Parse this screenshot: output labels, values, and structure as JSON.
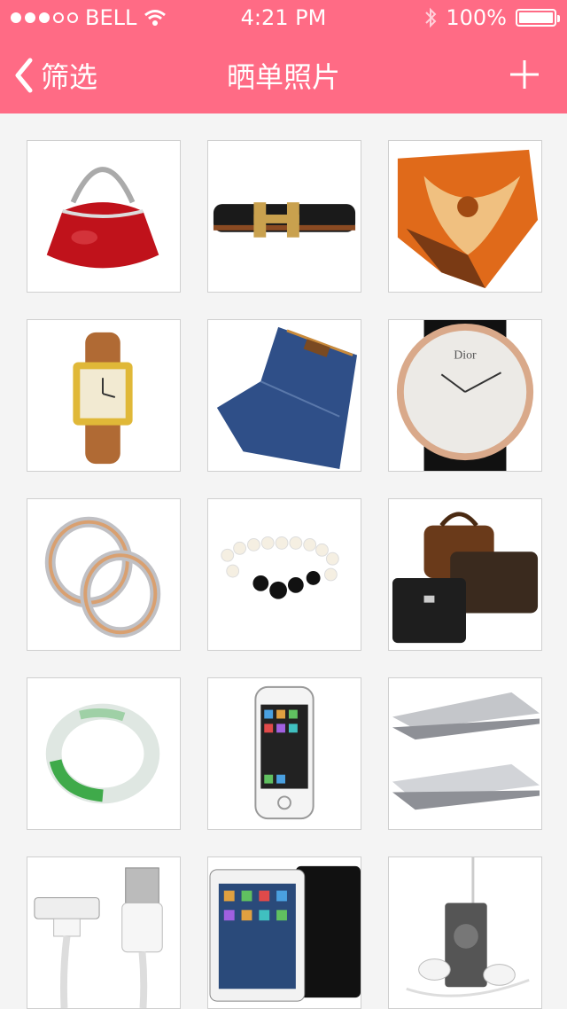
{
  "status_bar": {
    "carrier": "BELL",
    "time": "4:21 PM",
    "battery": "100%"
  },
  "navbar": {
    "back_label": "筛选",
    "title": "晒单照片",
    "add_icon": "plus-icon"
  },
  "photos": [
    {
      "name": "red-handbag-photo"
    },
    {
      "name": "belt-photo"
    },
    {
      "name": "scarf-photo"
    },
    {
      "name": "wristwatch-photo"
    },
    {
      "name": "jeans-photo"
    },
    {
      "name": "dior-watch-photo"
    },
    {
      "name": "rings-photo"
    },
    {
      "name": "pearl-bracelet-photo"
    },
    {
      "name": "leather-bags-photo"
    },
    {
      "name": "jade-bangle-photo"
    },
    {
      "name": "iphone-photo"
    },
    {
      "name": "macbook-photo"
    },
    {
      "name": "usb-cable-photo"
    },
    {
      "name": "ipad-photo"
    },
    {
      "name": "ipod-earphones-photo"
    }
  ],
  "colors": {
    "header": "#ff6b85",
    "background": "#f4f4f4"
  }
}
